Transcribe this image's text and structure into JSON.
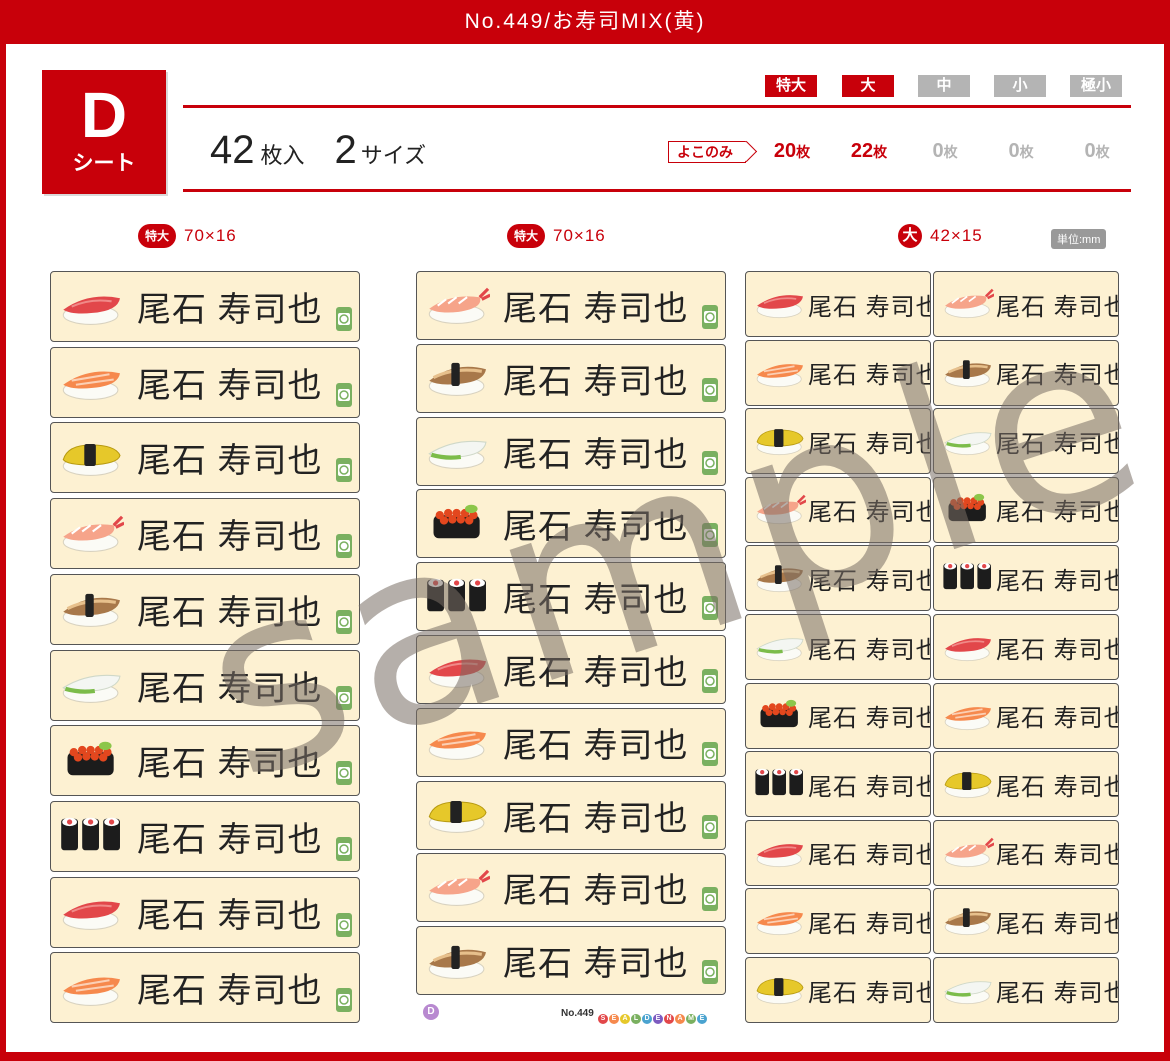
{
  "title": "No.449/お寿司MIX(黄)",
  "sheet": {
    "letter": "D",
    "sub": "シート"
  },
  "summary": {
    "count": "42",
    "count_unit": "枚入",
    "sizes": "2",
    "sizes_unit": "サイズ"
  },
  "size_tags": [
    {
      "label": "特大",
      "active": true
    },
    {
      "label": "大",
      "active": true
    },
    {
      "label": "中",
      "active": false
    },
    {
      "label": "小",
      "active": false
    },
    {
      "label": "極小",
      "active": false
    }
  ],
  "yoko_label": "よこのみ",
  "counts": [
    {
      "num": "20",
      "unit": "枚",
      "active": true
    },
    {
      "num": "22",
      "unit": "枚",
      "active": true
    },
    {
      "num": "0",
      "unit": "枚",
      "active": false
    },
    {
      "num": "0",
      "unit": "枚",
      "active": false
    },
    {
      "num": "0",
      "unit": "枚",
      "active": false
    }
  ],
  "columns": [
    {
      "badge": "特大",
      "dim": "70×16"
    },
    {
      "badge": "特大",
      "dim": "70×16"
    },
    {
      "badge": "大",
      "dim": "42×15"
    }
  ],
  "unit_note": "単位:mm",
  "name": "尾石 寿司也",
  "col1": [
    "tuna",
    "salmon",
    "tamago",
    "shrimp",
    "eel",
    "squid",
    "ikura",
    "maki",
    "tuna",
    "salmon"
  ],
  "col2": [
    "shrimp",
    "eel",
    "squid",
    "ikura",
    "maki",
    "tuna",
    "salmon",
    "tamago",
    "shrimp",
    "eel"
  ],
  "col3a": [
    "tuna",
    "salmon",
    "tamago",
    "shrimp",
    "eel",
    "squid",
    "ikura",
    "maki",
    "tuna",
    "salmon",
    "tamago"
  ],
  "col3b": [
    "shrimp",
    "eel",
    "squid",
    "ikura",
    "maki",
    "tuna",
    "salmon",
    "tamago",
    "shrimp",
    "eel",
    "squid"
  ],
  "footer": {
    "sheet": "D",
    "no": "No.449",
    "brand": "SEALDENAME"
  },
  "watermark": "sample"
}
